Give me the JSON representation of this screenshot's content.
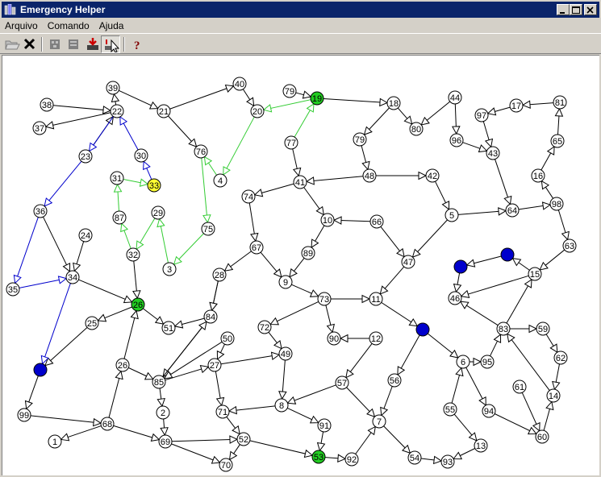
{
  "window": {
    "title": "Emergency Helper"
  },
  "menu": {
    "items": [
      "Arquivo",
      "Comando",
      "Ajuda"
    ]
  },
  "toolbar": {
    "icons": [
      "open-folder-icon",
      "close-x-icon",
      "network-a-icon",
      "network-b-icon",
      "download-icon",
      "set-marker-icon",
      "help-icon"
    ]
  },
  "colors": {
    "titlebar": "#0a246a",
    "green_path": "#33cc33",
    "blue_path": "#0000cc",
    "node_fill": "#ffffff",
    "green_node": "#22cc22",
    "yellow_node": "#ffff33",
    "blue_node": "#0000cc"
  },
  "graph": {
    "nodes": [
      {
        "id": "39",
        "label": "39"
      },
      {
        "id": "40",
        "label": "40"
      },
      {
        "id": "79a",
        "label": "79"
      },
      {
        "id": "19",
        "label": "19",
        "fill": "green"
      },
      {
        "id": "18",
        "label": "18"
      },
      {
        "id": "44",
        "label": "44"
      },
      {
        "id": "81",
        "label": "81"
      },
      {
        "id": "38",
        "label": "38"
      },
      {
        "id": "22",
        "label": "22"
      },
      {
        "id": "21",
        "label": "21"
      },
      {
        "id": "20",
        "label": "20"
      },
      {
        "id": "17",
        "label": "17"
      },
      {
        "id": "97",
        "label": "97"
      },
      {
        "id": "80",
        "label": "80"
      },
      {
        "id": "37",
        "label": "37"
      },
      {
        "id": "77",
        "label": "77"
      },
      {
        "id": "79",
        "label": "79"
      },
      {
        "id": "96",
        "label": "96"
      },
      {
        "id": "65",
        "label": "65"
      },
      {
        "id": "76",
        "label": "76"
      },
      {
        "id": "23",
        "label": "23"
      },
      {
        "id": "30",
        "label": "30"
      },
      {
        "id": "43",
        "label": "43"
      },
      {
        "id": "48",
        "label": "48"
      },
      {
        "id": "42",
        "label": "42"
      },
      {
        "id": "16",
        "label": "16"
      },
      {
        "id": "31",
        "label": "31"
      },
      {
        "id": "33",
        "label": "33",
        "fill": "yellow"
      },
      {
        "id": "4",
        "label": "4"
      },
      {
        "id": "41",
        "label": "41"
      },
      {
        "id": "74",
        "label": "74"
      },
      {
        "id": "98",
        "label": "98"
      },
      {
        "id": "36",
        "label": "36"
      },
      {
        "id": "87",
        "label": "87"
      },
      {
        "id": "29",
        "label": "29"
      },
      {
        "id": "5",
        "label": "5"
      },
      {
        "id": "64",
        "label": "64"
      },
      {
        "id": "10",
        "label": "10"
      },
      {
        "id": "66",
        "label": "66"
      },
      {
        "id": "75",
        "label": "75"
      },
      {
        "id": "24",
        "label": "24"
      },
      {
        "id": "67",
        "label": "67"
      },
      {
        "id": "63",
        "label": "63"
      },
      {
        "id": "32",
        "label": "32"
      },
      {
        "id": "89",
        "label": "89"
      },
      {
        "id": "b1",
        "label": "",
        "fill": "blue"
      },
      {
        "id": "47",
        "label": "47"
      },
      {
        "id": "3",
        "label": "3"
      },
      {
        "id": "b2",
        "label": "",
        "fill": "blue"
      },
      {
        "id": "15",
        "label": "15"
      },
      {
        "id": "28",
        "label": "28"
      },
      {
        "id": "9",
        "label": "9"
      },
      {
        "id": "35",
        "label": "35"
      },
      {
        "id": "34",
        "label": "34"
      },
      {
        "id": "46",
        "label": "46"
      },
      {
        "id": "73",
        "label": "73"
      },
      {
        "id": "11",
        "label": "11"
      },
      {
        "id": "26",
        "label": "26",
        "fill": "green"
      },
      {
        "id": "84",
        "label": "84"
      },
      {
        "id": "25",
        "label": "25"
      },
      {
        "id": "51",
        "label": "51"
      },
      {
        "id": "83",
        "label": "83"
      },
      {
        "id": "59",
        "label": "59"
      },
      {
        "id": "72",
        "label": "72"
      },
      {
        "id": "b3",
        "label": "",
        "fill": "blue"
      },
      {
        "id": "50",
        "label": "50"
      },
      {
        "id": "90",
        "label": "90"
      },
      {
        "id": "12",
        "label": "12"
      },
      {
        "id": "49",
        "label": "49"
      },
      {
        "id": "62",
        "label": "62"
      },
      {
        "id": "6",
        "label": "6"
      },
      {
        "id": "95",
        "label": "95"
      },
      {
        "id": "b4",
        "label": "",
        "fill": "blue"
      },
      {
        "id": "26b",
        "label": "26"
      },
      {
        "id": "27",
        "label": "27"
      },
      {
        "id": "85",
        "label": "85"
      },
      {
        "id": "56",
        "label": "56"
      },
      {
        "id": "57",
        "label": "57"
      },
      {
        "id": "61",
        "label": "61"
      },
      {
        "id": "14",
        "label": "14"
      },
      {
        "id": "8",
        "label": "8"
      },
      {
        "id": "71",
        "label": "71"
      },
      {
        "id": "55",
        "label": "55"
      },
      {
        "id": "94",
        "label": "94"
      },
      {
        "id": "99",
        "label": "99"
      },
      {
        "id": "2",
        "label": "2"
      },
      {
        "id": "68",
        "label": "68"
      },
      {
        "id": "91",
        "label": "91"
      },
      {
        "id": "7",
        "label": "7"
      },
      {
        "id": "60",
        "label": "60"
      },
      {
        "id": "52",
        "label": "52"
      },
      {
        "id": "1",
        "label": "1"
      },
      {
        "id": "69",
        "label": "69"
      },
      {
        "id": "13",
        "label": "13"
      },
      {
        "id": "53",
        "label": "53",
        "fill": "green"
      },
      {
        "id": "92",
        "label": "92"
      },
      {
        "id": "54",
        "label": "54"
      },
      {
        "id": "93",
        "label": "93"
      },
      {
        "id": "70",
        "label": "70"
      }
    ],
    "edges": [
      [
        "39",
        "21",
        "k"
      ],
      [
        "21",
        "40",
        "k"
      ],
      [
        "40",
        "20",
        "k"
      ],
      [
        "38",
        "22",
        "k"
      ],
      [
        "22",
        "37",
        "k"
      ],
      [
        "23",
        "22",
        "k"
      ],
      [
        "22",
        "39",
        "k"
      ],
      [
        "21",
        "76",
        "k"
      ],
      [
        "79a",
        "19",
        "k"
      ],
      [
        "19",
        "18",
        "k"
      ],
      [
        "18",
        "80",
        "k"
      ],
      [
        "44",
        "80",
        "k"
      ],
      [
        "81",
        "17",
        "k"
      ],
      [
        "17",
        "97",
        "k"
      ],
      [
        "97",
        "43",
        "k"
      ],
      [
        "18",
        "79",
        "k"
      ],
      [
        "79",
        "48",
        "k"
      ],
      [
        "44",
        "96",
        "k"
      ],
      [
        "96",
        "43",
        "k"
      ],
      [
        "65",
        "81",
        "k"
      ],
      [
        "16",
        "65",
        "k"
      ],
      [
        "98",
        "16",
        "k"
      ],
      [
        "43",
        "64",
        "k"
      ],
      [
        "77",
        "19",
        "g"
      ],
      [
        "77",
        "41",
        "k"
      ],
      [
        "41",
        "74",
        "k"
      ],
      [
        "48",
        "41",
        "k"
      ],
      [
        "48",
        "42",
        "k"
      ],
      [
        "42",
        "5",
        "k"
      ],
      [
        "41",
        "10",
        "k"
      ],
      [
        "66",
        "10",
        "k"
      ],
      [
        "5",
        "64",
        "k"
      ],
      [
        "64",
        "98",
        "k"
      ],
      [
        "98",
        "63",
        "k"
      ],
      [
        "74",
        "67",
        "k"
      ],
      [
        "67",
        "28",
        "k"
      ],
      [
        "10",
        "89",
        "k"
      ],
      [
        "66",
        "47",
        "k"
      ],
      [
        "5",
        "47",
        "k"
      ],
      [
        "89",
        "9",
        "k"
      ],
      [
        "67",
        "9",
        "k"
      ],
      [
        "9",
        "73",
        "k"
      ],
      [
        "73",
        "11",
        "k"
      ],
      [
        "47",
        "11",
        "k"
      ],
      [
        "b1",
        "b2",
        "k"
      ],
      [
        "b2",
        "46",
        "k"
      ],
      [
        "63",
        "15",
        "k"
      ],
      [
        "15",
        "b1",
        "k"
      ],
      [
        "15",
        "46",
        "k"
      ],
      [
        "83",
        "15",
        "k"
      ],
      [
        "28",
        "84",
        "k"
      ],
      [
        "73",
        "72",
        "k"
      ],
      [
        "73",
        "90",
        "k"
      ],
      [
        "12",
        "90",
        "k"
      ],
      [
        "72",
        "49",
        "k"
      ],
      [
        "11",
        "b3",
        "k"
      ],
      [
        "b3",
        "6",
        "k"
      ],
      [
        "b3",
        "56",
        "k"
      ],
      [
        "83",
        "59",
        "k"
      ],
      [
        "59",
        "62",
        "k"
      ],
      [
        "62",
        "14",
        "k"
      ],
      [
        "83",
        "46",
        "k"
      ],
      [
        "6",
        "95",
        "k"
      ],
      [
        "95",
        "83",
        "k"
      ],
      [
        "14",
        "83",
        "k"
      ],
      [
        "61",
        "60",
        "k"
      ],
      [
        "60",
        "14",
        "k"
      ],
      [
        "6",
        "94",
        "k"
      ],
      [
        "55",
        "6",
        "k"
      ],
      [
        "55",
        "13",
        "k"
      ],
      [
        "84",
        "85",
        "k"
      ],
      [
        "84",
        "51",
        "k"
      ],
      [
        "26",
        "51",
        "k"
      ],
      [
        "26",
        "25",
        "k"
      ],
      [
        "26b",
        "26",
        "k"
      ],
      [
        "26b",
        "85",
        "k"
      ],
      [
        "85",
        "27",
        "k"
      ],
      [
        "27",
        "49",
        "k"
      ],
      [
        "50",
        "27",
        "k"
      ],
      [
        "50",
        "85",
        "k"
      ],
      [
        "27",
        "71",
        "k"
      ],
      [
        "49",
        "8",
        "k"
      ],
      [
        "57",
        "8",
        "k"
      ],
      [
        "8",
        "71",
        "k"
      ],
      [
        "8",
        "91",
        "k"
      ],
      [
        "91",
        "53",
        "k"
      ],
      [
        "12",
        "57",
        "k"
      ],
      [
        "57",
        "7",
        "k"
      ],
      [
        "56",
        "7",
        "k"
      ],
      [
        "7",
        "54",
        "k"
      ],
      [
        "54",
        "93",
        "k"
      ],
      [
        "13",
        "93",
        "k"
      ],
      [
        "94",
        "60",
        "k"
      ],
      [
        "71",
        "52",
        "k"
      ],
      [
        "52",
        "53",
        "k"
      ],
      [
        "53",
        "92",
        "k"
      ],
      [
        "92",
        "7",
        "k"
      ],
      [
        "52",
        "70",
        "k"
      ],
      [
        "69",
        "70",
        "k"
      ],
      [
        "69",
        "52",
        "k"
      ],
      [
        "85",
        "2",
        "k"
      ],
      [
        "2",
        "69",
        "k"
      ],
      [
        "68",
        "69",
        "k"
      ],
      [
        "68",
        "1",
        "k"
      ],
      [
        "99",
        "68",
        "k"
      ],
      [
        "b4",
        "99",
        "k"
      ],
      [
        "68",
        "26b",
        "k"
      ],
      [
        "25",
        "b4",
        "k"
      ],
      [
        "34",
        "26",
        "k"
      ],
      [
        "36",
        "34",
        "k"
      ],
      [
        "24",
        "34",
        "k"
      ],
      [
        "85",
        "84",
        "k"
      ],
      [
        "32",
        "26",
        "k"
      ],
      [
        "28",
        "84",
        "k"
      ],
      [
        "19",
        "20",
        "g"
      ],
      [
        "20",
        "4",
        "g"
      ],
      [
        "4",
        "76",
        "g"
      ],
      [
        "76",
        "75",
        "g"
      ],
      [
        "75",
        "3",
        "g"
      ],
      [
        "3",
        "29",
        "g"
      ],
      [
        "29",
        "32",
        "g"
      ],
      [
        "32",
        "87",
        "g"
      ],
      [
        "87",
        "31",
        "g"
      ],
      [
        "31",
        "33",
        "g"
      ],
      [
        "33",
        "30",
        "bl"
      ],
      [
        "30",
        "22",
        "bl"
      ],
      [
        "22",
        "23",
        "bl"
      ],
      [
        "23",
        "36",
        "bl"
      ],
      [
        "36",
        "35",
        "bl"
      ],
      [
        "35",
        "34",
        "bl"
      ],
      [
        "34",
        "b4",
        "bl"
      ]
    ]
  }
}
